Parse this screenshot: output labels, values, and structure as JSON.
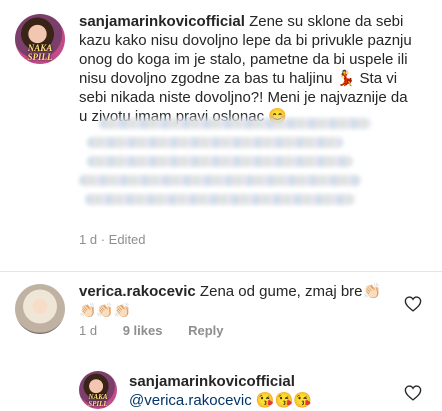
{
  "comment1": {
    "username": "sanjamarinkovicofficial",
    "avatar_text": "NAKA SPILL",
    "text": " Zene su sklone da sebi kazu kako nisu dovoljno lepe da bi privukle paznju onog do koga im je stalo, pametne da bi uspele ili nisu dovoljno zgodne za bas tu haljinu 💃 Sta vi sebi nikada niste dovoljno?! Meni je najvaznije da u zivotu imam pravi oslonac 😊",
    "age": "1 d",
    "edited": "Edited"
  },
  "comment2": {
    "username": "verica.rakocevic",
    "text": " Zena od gume, zmaj bre👏🏻",
    "emoji_line": "👏🏻👏🏻👏🏻",
    "age": "1 d",
    "likes": "9 likes",
    "reply": "Reply"
  },
  "comment3": {
    "username": "sanjamarinkovicofficial",
    "avatar_text": "NAKA SPILL",
    "mention": "@verica.rakocevic",
    "emojis": " 😘😘😘"
  },
  "icons": [
    "heart-outline-icon",
    "heart-outline-icon"
  ],
  "colors": {
    "text": "#262626",
    "meta": "#8e8e8e",
    "mention": "#003569"
  }
}
